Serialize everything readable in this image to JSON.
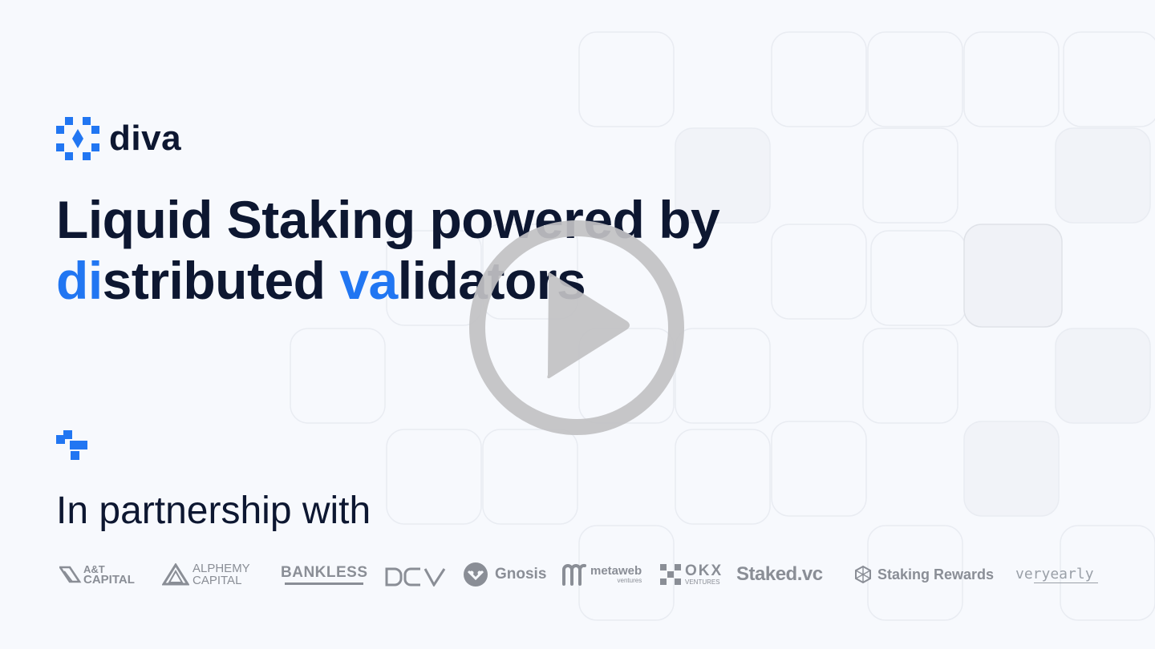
{
  "brand": {
    "name": "diva",
    "accent": "#2176f2",
    "text_color": "#0d1731"
  },
  "headline": {
    "line1": "Liquid Staking powered by",
    "line2_part1": "di",
    "line2_part2": "stributed ",
    "line2_part3": "va",
    "line2_part4": "lidators"
  },
  "partners_section": {
    "title": "In partnership with",
    "partners": [
      {
        "line1": "A&T",
        "line2": "CAPITAL"
      },
      {
        "line1": "ALPHEMY",
        "line2": "CAPITAL"
      },
      {
        "name": "BANKLESS"
      },
      {
        "name": "dcv"
      },
      {
        "name": "Gnosis"
      },
      {
        "name": "metaweb",
        "sub": "ventures"
      },
      {
        "name": "OKX",
        "sub": "VENTURES"
      },
      {
        "name": "Staked.vc"
      },
      {
        "name": "Staking Rewards"
      },
      {
        "name": "veryearly"
      }
    ]
  },
  "video": {
    "play_icon": "play-icon"
  }
}
